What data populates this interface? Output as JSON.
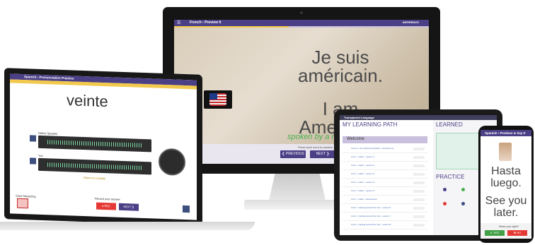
{
  "desktop": {
    "breadcrumb": "French › Preview It",
    "header_right": "INFERENCE",
    "line1": "Je suis",
    "line2": "américain.",
    "line3": "I am",
    "line4": "American.",
    "spoken": "spoken by a male.",
    "hint": "Press each word to practice",
    "prev_label": "❮ PREVIOUS",
    "next_label": "NEXT ❯",
    "progress": 0.45
  },
  "laptop": {
    "breadcrumb": "Spanish › Pronunciation Practice",
    "word": "veinte",
    "native_label": "Native Speaker",
    "you_label": "You",
    "tip": "Show on a replay",
    "voice_label": "Voice Mastering",
    "record_label": "Record your answer",
    "rec_button": "● REC",
    "next_button": "NEXT ❯"
  },
  "tablet": {
    "brand": "Transparent Language",
    "left_title": "MY LEARNING PATH",
    "welcome": "Welcome",
    "right_title": "LEARNED",
    "practice_title": "PRACTICE",
    "zero": "0",
    "rows": [
      "Learn to Use Spanish Alphabet - Assessment",
      "Unit 1 - Hello! - Lesson 1",
      "Unit 1 - Hello! - Lesson 2",
      "Unit 1 - Hello! - Lesson 3",
      "Unit 1 - Hello! - Lesson 4",
      "Unit 1 - Hello! - Lesson 5",
      "Unit 1 - Hello! - Assessment",
      "Unit 2 - Getting around the City - Lesson 6",
      "Unit 2 - Getting around the City - Lesson 7",
      "Unit 2 - Getting around the City - Lesson 8"
    ]
  },
  "phone": {
    "breadcrumb": "Spanish › Produce & Say It",
    "line1": "Hasta",
    "line2": "luego.",
    "line3": "See you",
    "line4": "later.",
    "question": "Were you right?",
    "yes": "✔ YES",
    "no": "✖ NO"
  },
  "colors": {
    "brand_purple": "#4b3f86",
    "accent_yellow": "#f2c94c",
    "spoken_green": "#4caf50"
  },
  "icons": [
    "menu-icon",
    "flag-icon",
    "speaker-icon",
    "microphone-icon",
    "play-icon"
  ]
}
